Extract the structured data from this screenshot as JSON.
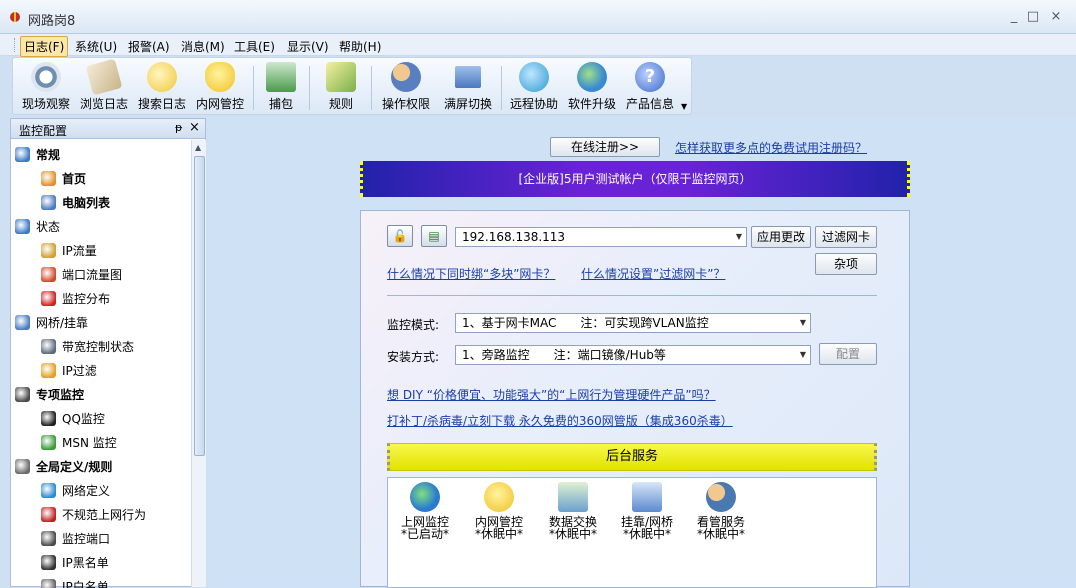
{
  "window": {
    "title": "网路岗8",
    "controls": [
      "_",
      "□",
      "×"
    ]
  },
  "menu": [
    "日志(F)",
    "系统(U)",
    "报警(A)",
    "消息(M)",
    "工具(E)",
    "显示(V)",
    "帮助(H)"
  ],
  "toolbar": [
    {
      "label": "现场观察",
      "icon": "eye-icon",
      "color": "#6f8fb0"
    },
    {
      "label": "浏览日志",
      "icon": "book-icon",
      "color": "#c9b48a"
    },
    {
      "label": "搜索日志",
      "icon": "search-icon",
      "color": "#f0c63a"
    },
    {
      "label": "内网管控",
      "icon": "bulb-icon",
      "color": "#f2c020"
    },
    {
      "label": "捕包",
      "icon": "capture-icon",
      "color": "#4a9a4a"
    },
    {
      "label": "规则",
      "icon": "rule-icon",
      "color": "#7ab04a"
    },
    {
      "label": "操作权限",
      "icon": "users-icon",
      "color": "#5a7fc0"
    },
    {
      "label": "满屏切换",
      "icon": "screen-icon",
      "color": "#4a78c0"
    },
    {
      "label": "远程协助",
      "icon": "remote-icon",
      "color": "#2a9ad0"
    },
    {
      "label": "软件升级",
      "icon": "globe-icon",
      "color": "#3a8ad0"
    },
    {
      "label": "产品信息",
      "icon": "help-icon",
      "color": "#3a6ac8"
    }
  ],
  "sidebar": {
    "title": "监控配置",
    "tree": [
      {
        "label": "常规",
        "bold": true,
        "icon": "globe-icon",
        "color": "#3a78c8"
      },
      {
        "label": "首页",
        "bold": true,
        "icon": "home-icon",
        "color": "#e0902a",
        "selected": true
      },
      {
        "label": "电脑列表",
        "bold": true,
        "icon": "computers-icon",
        "color": "#4a7ac0"
      },
      {
        "label": "状态",
        "bold": false,
        "icon": "globe-icon",
        "color": "#3a78c8"
      },
      {
        "label": "IP流量",
        "bold": false,
        "icon": "chart-icon",
        "color": "#d0a030"
      },
      {
        "label": "端口流量图",
        "bold": false,
        "icon": "pie-icon",
        "color": "#d04a2a"
      },
      {
        "label": "监控分布",
        "bold": false,
        "icon": "exclamation-icon",
        "color": "#d02020"
      },
      {
        "label": "网桥/挂靠",
        "bold": false,
        "icon": "network-icon",
        "color": "#4a7ac0"
      },
      {
        "label": "带宽控制状态",
        "bold": false,
        "icon": "graph-icon",
        "color": "#5a6a7a"
      },
      {
        "label": "IP过滤",
        "bold": false,
        "icon": "shield-icon",
        "color": "#e0a020"
      },
      {
        "label": "专项监控",
        "bold": true,
        "icon": "target-icon",
        "color": "#4a4a4a"
      },
      {
        "label": "QQ监控",
        "bold": false,
        "icon": "qq-icon",
        "color": "#202020"
      },
      {
        "label": "MSN 监控",
        "bold": false,
        "icon": "msn-icon",
        "color": "#3a9a3a"
      },
      {
        "label": "全局定义/规则",
        "bold": true,
        "icon": "gear-icon",
        "color": "#6a6a6a"
      },
      {
        "label": "网络定义",
        "bold": false,
        "icon": "globe-icon",
        "color": "#2a8ad0"
      },
      {
        "label": "不规范上网行为",
        "bold": false,
        "icon": "diamond-icon",
        "color": "#c02020"
      },
      {
        "label": "监控端口",
        "bold": false,
        "icon": "target-icon",
        "color": "#4a4a4a"
      },
      {
        "label": "IP黑名单",
        "bold": false,
        "icon": "ip-black-icon",
        "color": "#303030"
      },
      {
        "label": "IP白名单",
        "bold": false,
        "icon": "ip-white-icon",
        "color": "#606060"
      }
    ]
  },
  "main": {
    "register_btn": "在线注册>>",
    "register_link": "怎样获取更多点的免费试用注册码？",
    "banner": "[企业版]5用户测试帐户（仅限于监控网页）",
    "ip_value": "192.168.138.113",
    "apply_btn": "应用更改",
    "filter_btn": "过滤网卡",
    "misc_btn": "杂项",
    "link_multi": "什么情况下同时绑“多块”网卡？",
    "link_filter": "什么情况设置”过滤网卡”？",
    "mode_label": "监控模式:",
    "mode_value": "1、基于网卡MAC　　注：可实现跨VLAN监控",
    "install_label": "安装方式:",
    "install_value": "1、旁路监控　　注：端口镜像/Hub等",
    "config_btn": "配置",
    "link_diy": "想 DIY “价格便宜、功能强大”的“上网行为管理硬件产品”吗？",
    "link_360": "打补丁/杀病毒/立刻下载 永久免费的360网管版（集成360杀毒）",
    "services_title": "后台服务",
    "services": [
      {
        "name": "上网监控",
        "status": "*已启动*",
        "icon": "globe-check-icon",
        "color": "#2a7ad0"
      },
      {
        "name": "内网管控",
        "status": "*休眠中*",
        "icon": "bulb-icon",
        "color": "#f0c020"
      },
      {
        "name": "数据交换",
        "status": "*休眠中*",
        "icon": "exchange-icon",
        "color": "#6aa0d0"
      },
      {
        "name": "挂靠/网桥",
        "status": "*休眠中*",
        "icon": "bridge-icon",
        "color": "#5a8ad0"
      },
      {
        "name": "看管服务",
        "status": "*休眠中*",
        "icon": "watch-icon",
        "color": "#4a78b0"
      }
    ]
  }
}
